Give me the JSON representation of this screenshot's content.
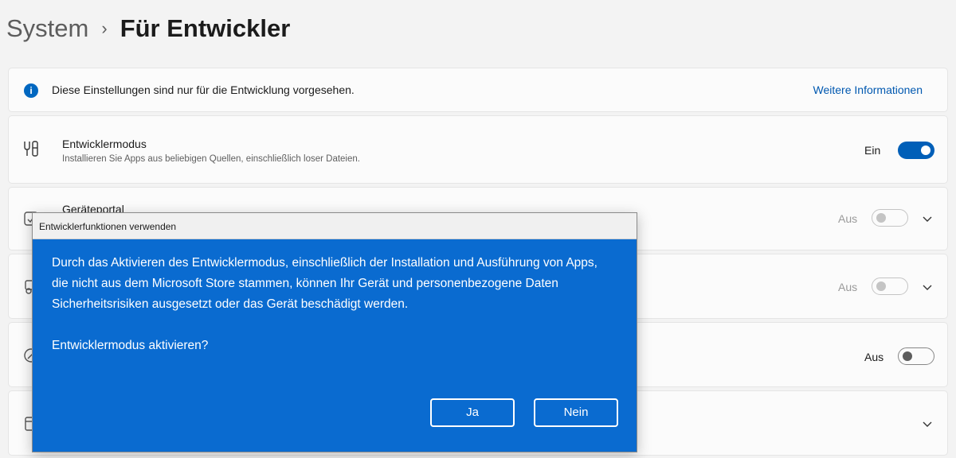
{
  "breadcrumb": {
    "parent": "System",
    "separator": "›",
    "current": "Für Entwickler"
  },
  "info": {
    "icon": "info-icon",
    "text": "Diese Einstellungen sind nur für die Entwicklung vorgesehen.",
    "link": "Weitere Informationen"
  },
  "rows": [
    {
      "icon": "developer-tools-icon",
      "title": "Entwicklermodus",
      "subtitle": "Installieren Sie Apps aus beliebigen Quellen, einschließlich loser Dateien.",
      "toggle_label": "Ein",
      "toggle_state": "on"
    },
    {
      "icon": "device-portal-icon",
      "title": "Geräteportal",
      "toggle_label": "Aus",
      "toggle_state": "off-disabled",
      "expand_icon": "chevron-down-icon"
    },
    {
      "icon": "device-discovery-icon",
      "toggle_label": "Aus",
      "toggle_state": "off-disabled",
      "expand_icon": "chevron-down-icon"
    },
    {
      "icon": "gauge-icon",
      "toggle_label": "Aus",
      "toggle_state": "off"
    },
    {
      "icon": "storage-icon",
      "expand_icon": "chevron-down-icon"
    }
  ],
  "dialog": {
    "title": "Entwicklerfunktionen verwenden",
    "message": "Durch das Aktivieren des Entwicklermodus, einschließlich der Installation und Ausführung von Apps, die nicht aus dem Microsoft Store stammen, können Ihr Gerät und personenbezogene Daten Sicherheitsrisiken ausgesetzt oder das Gerät beschädigt werden.",
    "question": "Entwicklermodus aktivieren?",
    "yes_label": "Ja",
    "no_label": "Nein"
  },
  "colors": {
    "accent": "#005fb8",
    "dialog_bg": "#0a6bd0",
    "link": "#0058b0"
  }
}
